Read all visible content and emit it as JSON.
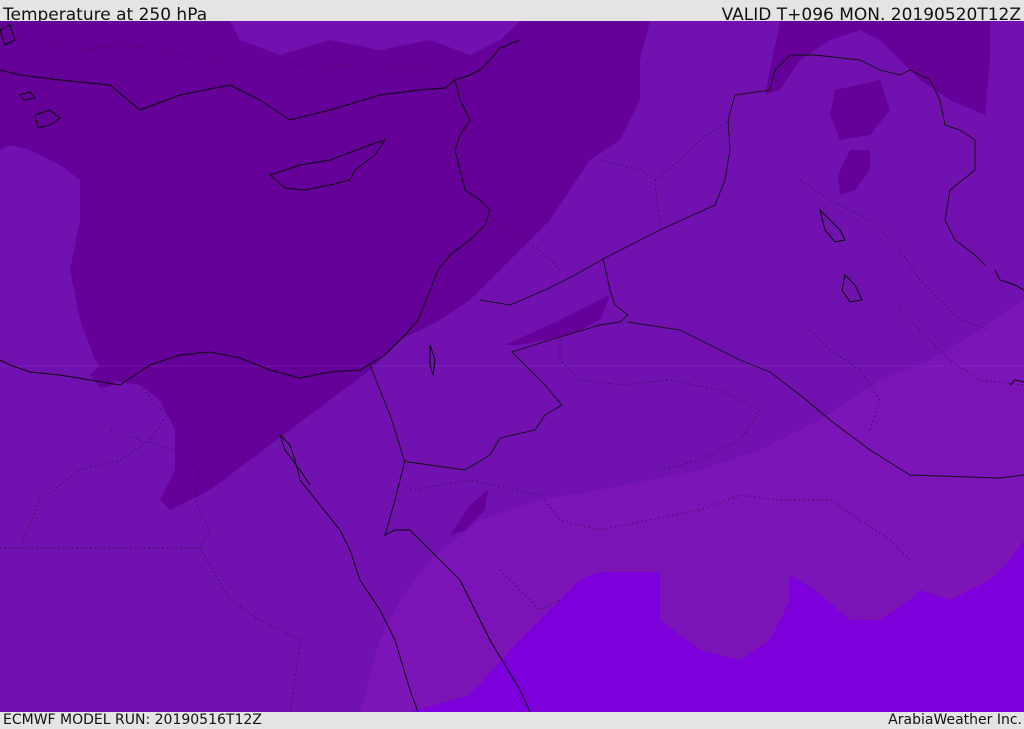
{
  "header": {
    "title": "Temperature at 250 hPa",
    "valid_time": "VALID T+096 MON. 20190520T12Z"
  },
  "footer": {
    "model_run": "ECMWF MODEL RUN: 20190516T12Z",
    "credit": "ArabiaWeather Inc."
  },
  "colors": {
    "band_coldest": "#650099",
    "band_cold": "#7112b0",
    "band_mid": "#7b15b7",
    "band_warm": "#7d00dc",
    "coastline": "#0a0a0a",
    "border_dotted": "#3a0a55"
  }
}
